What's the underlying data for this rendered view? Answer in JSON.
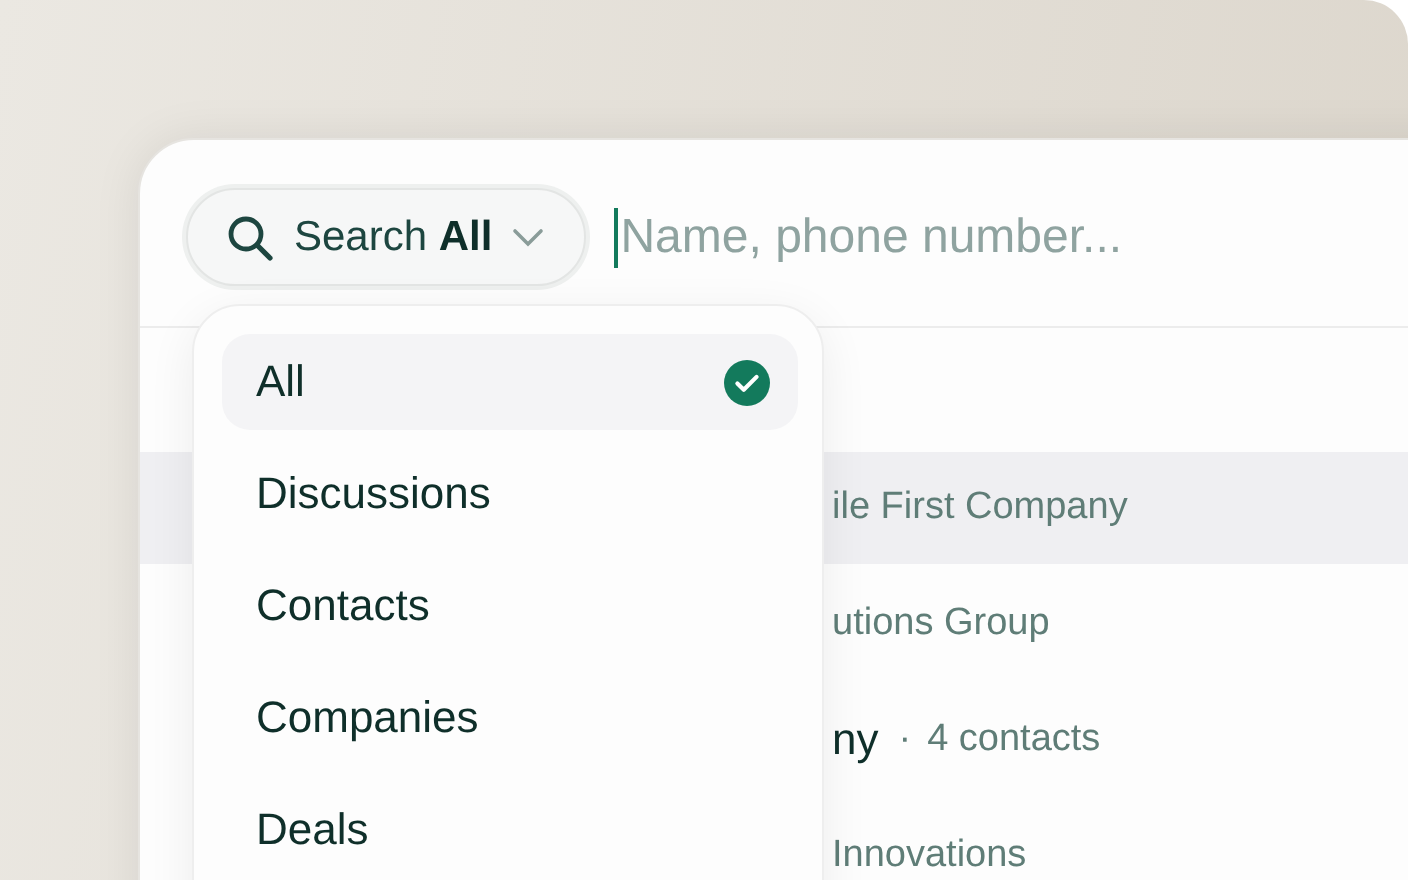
{
  "search_scope": {
    "label": "Search",
    "value": "All",
    "expanded": true
  },
  "search_field": {
    "placeholder": "Name, phone number..."
  },
  "scope_menu": [
    {
      "label": "All",
      "selected": true
    },
    {
      "label": "Discussions",
      "selected": false
    },
    {
      "label": "Contacts",
      "selected": false
    },
    {
      "label": "Companies",
      "selected": false
    },
    {
      "label": "Deals",
      "selected": false
    }
  ],
  "results": [
    {
      "kind": "subtitle",
      "text": "ile First Company",
      "selected": true
    },
    {
      "kind": "subtitle",
      "text": "utions Group",
      "selected": false
    },
    {
      "kind": "title",
      "text": "ny",
      "separator": "·",
      "meta": "4 contacts",
      "selected": false
    },
    {
      "kind": "subtitle",
      "text": "Innovations",
      "selected": false
    }
  ]
}
